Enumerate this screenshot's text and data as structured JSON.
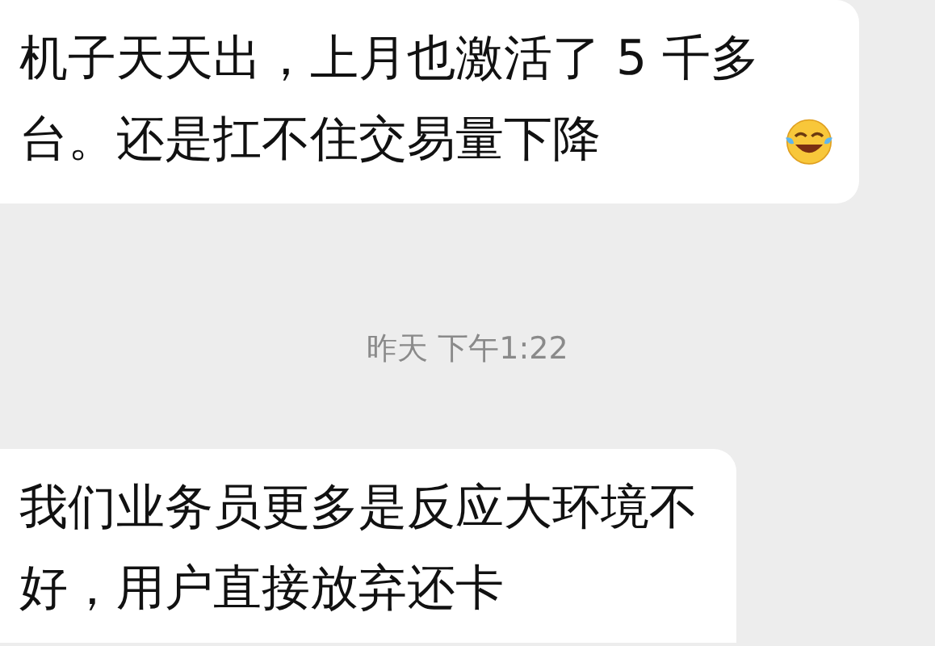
{
  "messages": [
    {
      "kind": "bubble",
      "parts": [
        {
          "kind": "text",
          "text": "机子天天出，上月也激活了 5 千多台。还是扛不住交易量下降"
        },
        {
          "kind": "emoji"
        }
      ]
    },
    {
      "kind": "time",
      "text": "昨天 下午1:22"
    },
    {
      "kind": "bubble",
      "parts": [
        {
          "kind": "text",
          "text": "我们业务员更多是反应大环境不好，用户直接放弃还卡"
        }
      ]
    }
  ]
}
